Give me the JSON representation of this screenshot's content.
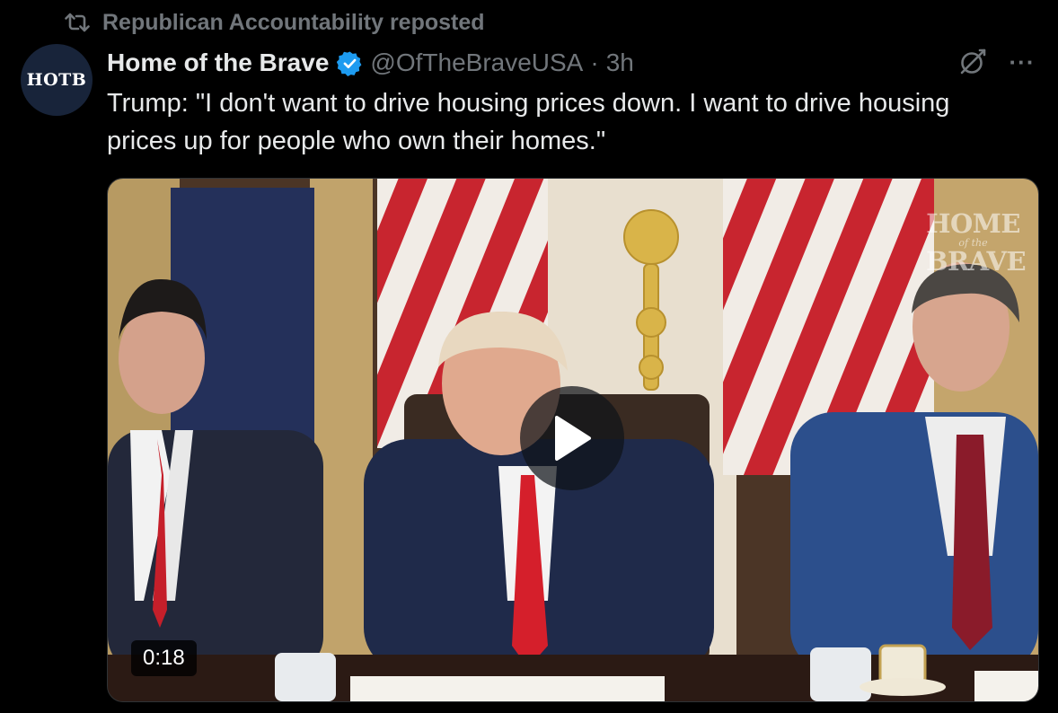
{
  "social_context": {
    "icon": "repost-icon",
    "text": "Republican Accountability reposted"
  },
  "author": {
    "avatar_text": "HOTB",
    "name": "Home of the Brave",
    "verified_icon": "verified-badge-icon",
    "handle": "@OfTheBraveUSA",
    "separator": "·",
    "time": "3h"
  },
  "actions": {
    "grok_icon": "grok-icon",
    "more_label": "···"
  },
  "tweet": {
    "text": "Trump: \"I don't want to drive housing prices down. I want to drive housing prices up for people who own their homes.\""
  },
  "media": {
    "type": "video",
    "watermark": [
      "HOME",
      "of the",
      "BRAVE"
    ],
    "play_icon": "play-icon",
    "duration": "0:18"
  },
  "colors": {
    "background": "#000000",
    "text_primary": "#e7e9ea",
    "text_secondary": "#71767b",
    "verified_blue": "#1d9bf0",
    "avatar_bg": "#18243a"
  }
}
